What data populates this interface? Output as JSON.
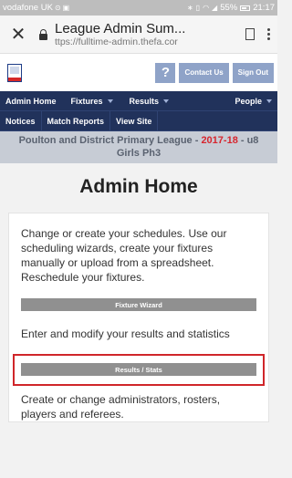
{
  "status_bar": {
    "carrier": "vodafone UK",
    "battery": "55%",
    "time": "21:17"
  },
  "browser": {
    "page_title": "League Admin Sum...",
    "url": "ttps://fulltime-admin.thefa.cor"
  },
  "header": {
    "help_label": "?",
    "contact_label": "Contact Us",
    "signout_label": "Sign Out"
  },
  "nav": {
    "row1": [
      "Admin Home",
      "Fixtures",
      "Results",
      "People"
    ],
    "row2": [
      "Notices",
      "Match Reports",
      "View Site"
    ]
  },
  "league": {
    "prefix": "Poulton and District Primary League - ",
    "season": "2017-18",
    "suffix": " - u8 Girls Ph3"
  },
  "main": {
    "title": "Admin Home",
    "fixtures_text": "Change or create your schedules. Use our scheduling wizards, create your fixtures manually or upload from a spreadsheet. Reschedule your fixtures.",
    "fixture_wizard_label": "Fixture Wizard",
    "results_text": "Enter and modify your results and statistics",
    "results_stats_label": "Results / Stats",
    "people_text": "Create or change administrators, rosters, players and referees."
  },
  "colors": {
    "nav_bg": "#21325b",
    "accent_red": "#d7262f",
    "highlight_border": "#d0262a"
  }
}
